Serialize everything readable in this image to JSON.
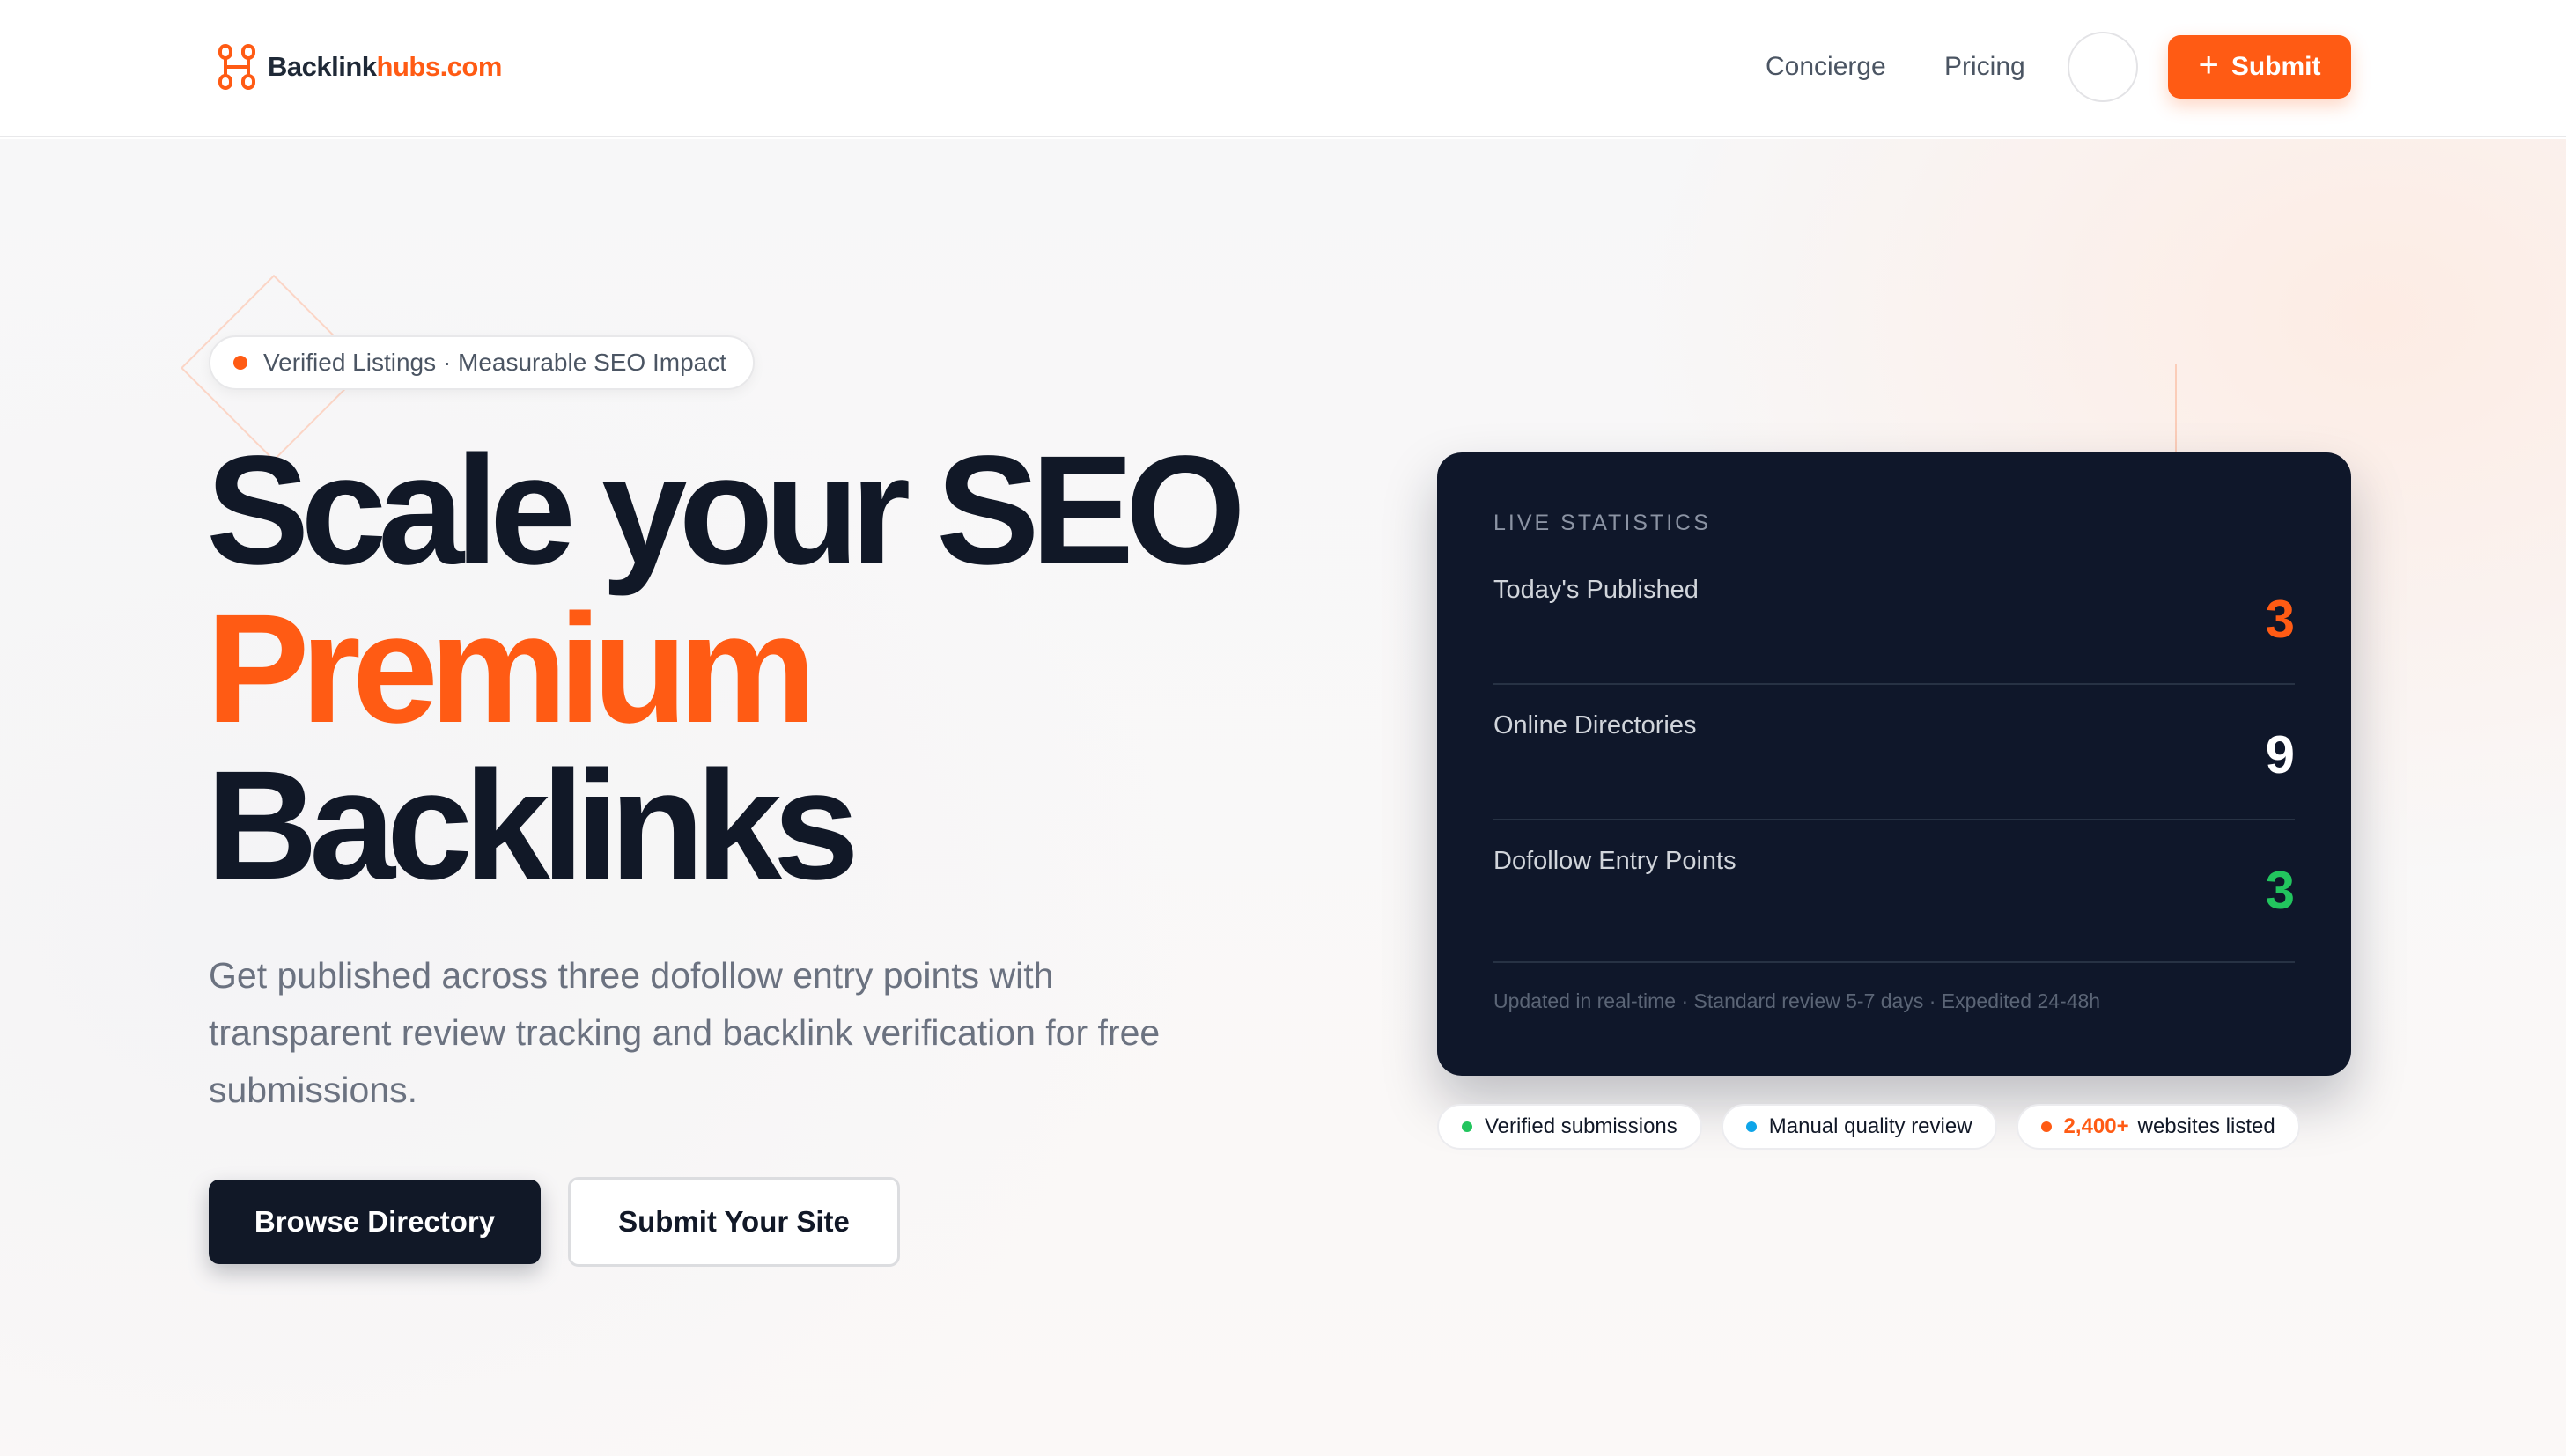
{
  "header": {
    "logo_part1": "Backlink",
    "logo_part2": "hubs.com",
    "nav": [
      "Concierge",
      "Pricing"
    ],
    "submit_label": "Submit",
    "submit_icon": "plus-icon"
  },
  "hero": {
    "pill_text": "Verified Listings · Measurable SEO Impact",
    "headline_line1": "Scale your SEO",
    "headline_line2": "Premium",
    "headline_line3": "Backlinks",
    "subheading": "Get published across three dofollow entry points with transparent review tracking and backlink verification for free submissions.",
    "primary_button": "Browse Directory",
    "secondary_button": "Submit Your Site"
  },
  "stats_card": {
    "label": "LIVE STATISTICS",
    "rows": [
      {
        "name": "Today's Published",
        "value": "3"
      },
      {
        "name": "Online Directories",
        "value": "9"
      },
      {
        "name": "Dofollow Entry Points",
        "value": "3"
      }
    ],
    "footer": "Updated in real-time · Standard review 5-7 days · Expedited 24-48h"
  },
  "badges": [
    {
      "text": "Verified submissions",
      "dot_color": "#22c55e"
    },
    {
      "text": "Manual quality review",
      "dot_color": "#0ea5e9"
    },
    {
      "highlight": "2,400+",
      "text": "websites listed",
      "dot_color": "#ff5b14"
    }
  ],
  "colors": {
    "accent": "#ff5b14",
    "dark": "#0f172a",
    "success": "#22c55e"
  }
}
